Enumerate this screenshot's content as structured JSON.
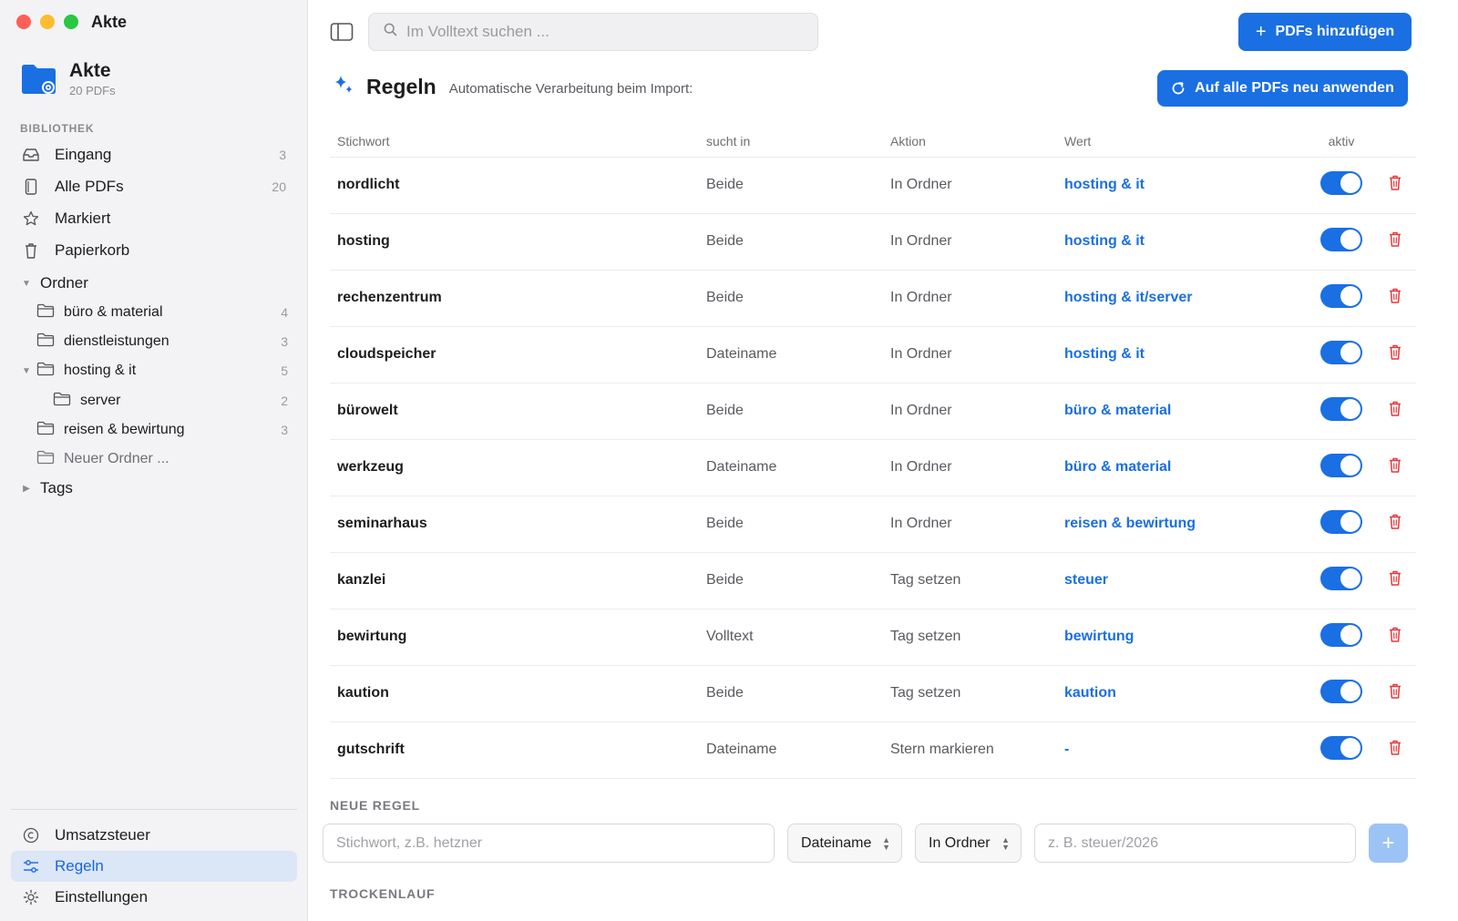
{
  "window": {
    "title": "Akte"
  },
  "library": {
    "name": "Akte",
    "count": "20 PDFs"
  },
  "sidebar": {
    "section_label": "BIBLIOTHEK",
    "items": [
      {
        "label": "Eingang",
        "count": "3",
        "icon": "inbox-icon"
      },
      {
        "label": "Alle PDFs",
        "count": "20",
        "icon": "document-icon"
      },
      {
        "label": "Markiert",
        "count": "",
        "icon": "star-icon"
      },
      {
        "label": "Papierkorb",
        "count": "",
        "icon": "trash-icon"
      }
    ],
    "folders_label": "Ordner",
    "folders": [
      {
        "label": "büro & material",
        "count": "4"
      },
      {
        "label": "dienstleistungen",
        "count": "3"
      },
      {
        "label": "hosting & it",
        "count": "5"
      },
      {
        "label": "server",
        "count": "2"
      },
      {
        "label": "reisen & bewirtung",
        "count": "3"
      },
      {
        "label": "Neuer Ordner ...",
        "count": ""
      }
    ],
    "tags_label": "Tags",
    "bottom": [
      {
        "label": "Umsatzsteuer",
        "icon": "copyright-icon"
      },
      {
        "label": "Regeln",
        "icon": "sliders-icon"
      },
      {
        "label": "Einstellungen",
        "icon": "gear-icon"
      }
    ]
  },
  "toolbar": {
    "search_placeholder": "Im Volltext suchen ...",
    "add_pdfs_label": "PDFs hinzufügen"
  },
  "rules": {
    "title": "Regeln",
    "subtitle": "Automatische Verarbeitung beim Import:",
    "reapply_label": "Auf alle PDFs neu anwenden",
    "columns": [
      "Stichwort",
      "sucht in",
      "Aktion",
      "Wert",
      "aktiv"
    ],
    "rows": [
      {
        "keyword": "nordlicht",
        "scope": "Beide",
        "action": "In Ordner",
        "value": "hosting & it",
        "active": true
      },
      {
        "keyword": "hosting",
        "scope": "Beide",
        "action": "In Ordner",
        "value": "hosting & it",
        "active": true
      },
      {
        "keyword": "rechenzentrum",
        "scope": "Beide",
        "action": "In Ordner",
        "value": "hosting & it/server",
        "active": true
      },
      {
        "keyword": "cloudspeicher",
        "scope": "Dateiname",
        "action": "In Ordner",
        "value": "hosting & it",
        "active": true
      },
      {
        "keyword": "bürowelt",
        "scope": "Beide",
        "action": "In Ordner",
        "value": "büro & material",
        "active": true
      },
      {
        "keyword": "werkzeug",
        "scope": "Dateiname",
        "action": "In Ordner",
        "value": "büro & material",
        "active": true
      },
      {
        "keyword": "seminarhaus",
        "scope": "Beide",
        "action": "In Ordner",
        "value": "reisen & bewirtung",
        "active": true
      },
      {
        "keyword": "kanzlei",
        "scope": "Beide",
        "action": "Tag setzen",
        "value": "steuer",
        "active": true
      },
      {
        "keyword": "bewirtung",
        "scope": "Volltext",
        "action": "Tag setzen",
        "value": "bewirtung",
        "active": true
      },
      {
        "keyword": "kaution",
        "scope": "Beide",
        "action": "Tag setzen",
        "value": "kaution",
        "active": true
      },
      {
        "keyword": "gutschrift",
        "scope": "Dateiname",
        "action": "Stern markieren",
        "value": "-",
        "active": true
      }
    ]
  },
  "new_rule": {
    "label": "NEUE REGEL",
    "keyword_placeholder": "Stichwort, z.B. hetzner",
    "scope_value": "Dateiname",
    "action_value": "In Ordner",
    "value_placeholder": "z. B. steuer/2026",
    "add_label": "+"
  },
  "dry_run": {
    "label": "TROCKENLAUF"
  },
  "colors": {
    "accent": "#1a6fe3",
    "delete": "#e5393c",
    "selected_bg": "#dbe6f7"
  }
}
